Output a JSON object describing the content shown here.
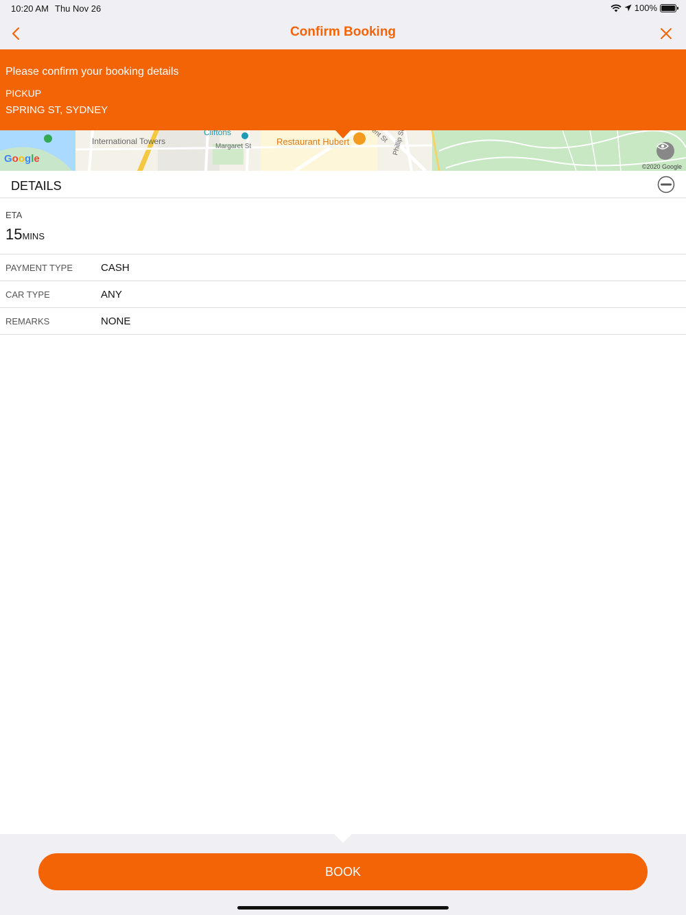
{
  "status_bar": {
    "time": "10:20 AM",
    "date": "Thu Nov 26",
    "battery": "100%"
  },
  "nav": {
    "title": "Confirm Booking",
    "back_icon": "chevron-left-icon",
    "close_icon": "close-icon"
  },
  "banner": {
    "message": "Please confirm your booking details",
    "pickup_label": "PICKUP",
    "pickup_value": "SPRING ST, SYDNEY"
  },
  "map": {
    "labels": {
      "clifftons": "Cliftons",
      "international_towers": "International Towers",
      "margaret_st": "Margaret St",
      "restaurant": "Restaurant Hubert",
      "phillip_st": "Phillip St",
      "bent_st": "ent St"
    },
    "logo": "Google",
    "copyright": "©2020 Google"
  },
  "details": {
    "title": "DETAILS",
    "eta_label": "ETA",
    "eta_value": "15",
    "eta_unit": "MINS",
    "rows": [
      {
        "label": "PAYMENT TYPE",
        "value": "CASH"
      },
      {
        "label": "CAR TYPE",
        "value": "ANY"
      },
      {
        "label": "REMARKS",
        "value": "NONE"
      }
    ]
  },
  "footer": {
    "book_label": "BOOK"
  },
  "colors": {
    "accent": "#f26406",
    "nav_bg": "#f0eff4",
    "divider": "#dddddd"
  }
}
